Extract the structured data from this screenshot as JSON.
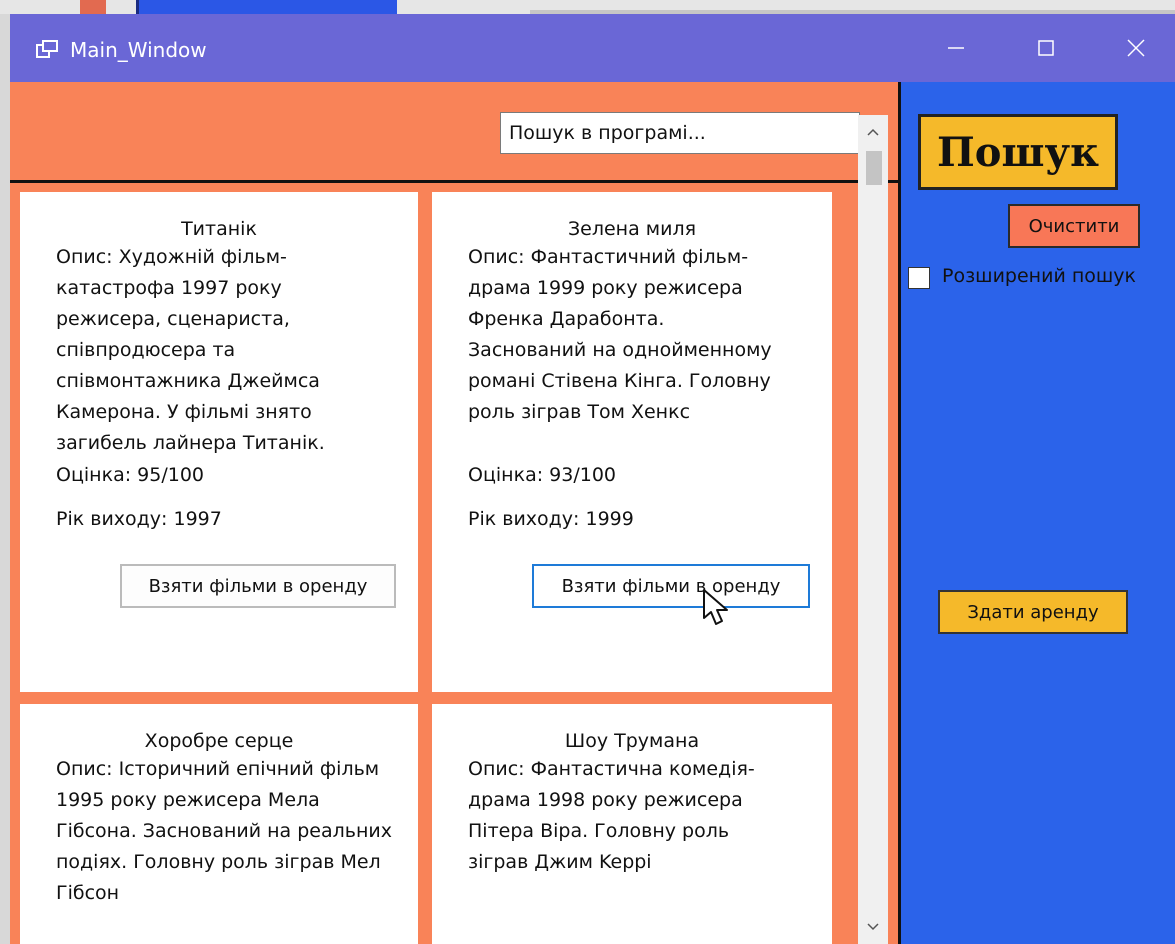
{
  "window": {
    "title": "Main_Window"
  },
  "search": {
    "placeholder": "Пошук в програмі...",
    "search_button": "Пошук",
    "clear_button": "Очистити",
    "advanced_label": "Розширений пошук",
    "return_button": "Здати аренду"
  },
  "movies": [
    {
      "title": "Титанік",
      "description": "Опис: Художній фільм-катастрофа 1997 року режисера, сценариста, співпродюсера та співмонтажника Джеймса Камерона. У фільмі знято загибель лайнера Титанік.",
      "rating": "Оцінка: 95/100",
      "year": "Рік виходу: 1997",
      "rent_button": "Взяти фільми в оренду"
    },
    {
      "title": "Зелена миля",
      "description": "Опис: Фантастичний фільм-драма 1999 року режисера Френка Дарабонта. Заснований на однойменному романі Стівена Кінга. Головну роль зіграв Том Хенкс",
      "rating": "Оцінка: 93/100",
      "year": "Рік виходу: 1999",
      "rent_button": "Взяти фільми в оренду"
    },
    {
      "title": "Хоробре серце",
      "description": "Опис: Історичний епічний фільм 1995 року режисера Мела Гібсона. Заснований на реальних подіях. Головну роль зіграв Мел Гібсон"
    },
    {
      "title": "Шоу Трумана",
      "description": "Опис: Фантастична комедія-драма 1998 року режисера Пітера Віра. Головну роль зіграв Джим Keppi"
    }
  ],
  "colors": {
    "titlebar": "#6a67d6",
    "content_bg": "#f98358",
    "sidebar_bg": "#2b63ea",
    "accent_yellow": "#f5b92a",
    "clear_red": "#f87757"
  }
}
